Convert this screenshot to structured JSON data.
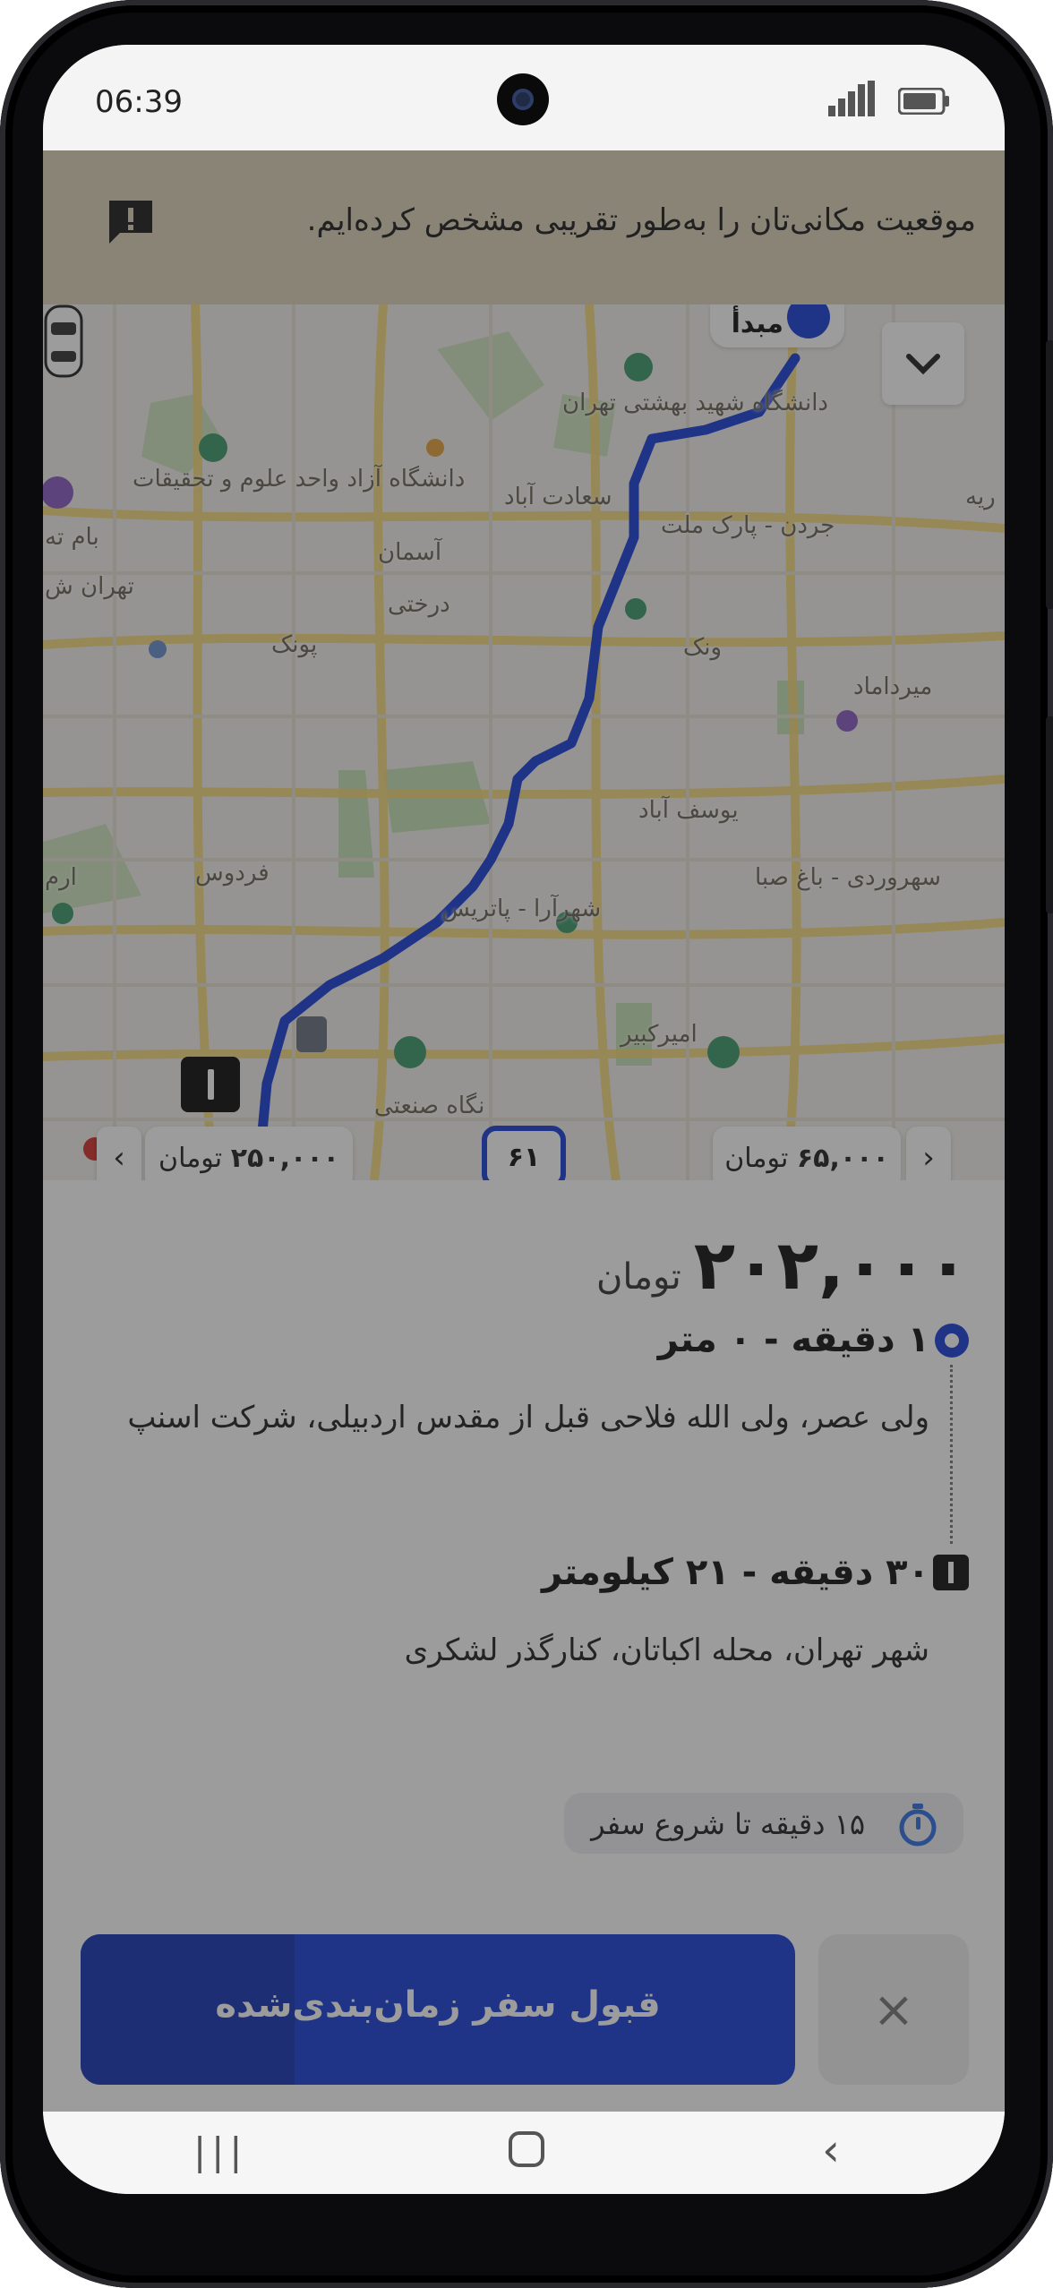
{
  "status_bar": {
    "time": "06:39"
  },
  "banner": {
    "text": "موقعیت مکانی‌تان را به‌طور تقریبی مشخص کرده‌ایم."
  },
  "map": {
    "origin_label": "مبدأ",
    "labels": {
      "shahid_beheshti": "دانشگاه شهید بهشتی تهران",
      "azad": "دانشگاه آزاد واحد علوم و تحقیقات",
      "saadat_abad": "سعادت آباد",
      "asman": "آسمان",
      "derakhti": "درختی",
      "punak": "پونک",
      "jordan": "جردن - پارک ملت",
      "vanak": "ونک",
      "mirdamad": "میرداماد",
      "yousef_abad": "یوسف آباد",
      "ferdows": "فردوس",
      "patris": "شهرآرا - پاتریس",
      "sohrevardi": "سهروردی - باغ صبا",
      "amirkabir": "امیرکبیر",
      "sanati": "نگاه صنعتی",
      "tehran_left": "تهران ش",
      "bam": "بام ته",
      "ram": "ارم",
      "rieh": "ریه"
    },
    "fare_left": {
      "amount": "۲۵۰,۰۰۰",
      "currency": "تومان"
    },
    "fare_right": {
      "amount": "۶۵,۰۰۰",
      "currency": "تومان"
    },
    "route_badge": "۶۱"
  },
  "trip": {
    "price": "۲۰۲,۰۰۰",
    "currency": "تومان",
    "origin": {
      "title": "۱ دقیقه - ۰ متر",
      "address": "ولی عصر، ولی الله فلاحی قبل از مقدس اردبیلی، شرکت اسنپ"
    },
    "destination": {
      "title": "۳۰ دقیقه - ۲۱ کیلومتر",
      "address": "شهر تهران، محله اکباتان، کنارگذر لشکری"
    },
    "timer_text": "۱۵ دقیقه تا شروع سفر",
    "accept_label": "قبول سفر زمان‌بندی‌شده",
    "accept_progress": 0.3,
    "close_symbol": "×"
  },
  "icons": {
    "banner": "alert-message-icon",
    "chevron": "chevron-down-icon",
    "timer": "stopwatch-icon",
    "close": "close-icon"
  },
  "colors": {
    "primary": "#1a3fd8",
    "banner_bg": "#ddd2b7",
    "route": "#1b3fd8"
  }
}
